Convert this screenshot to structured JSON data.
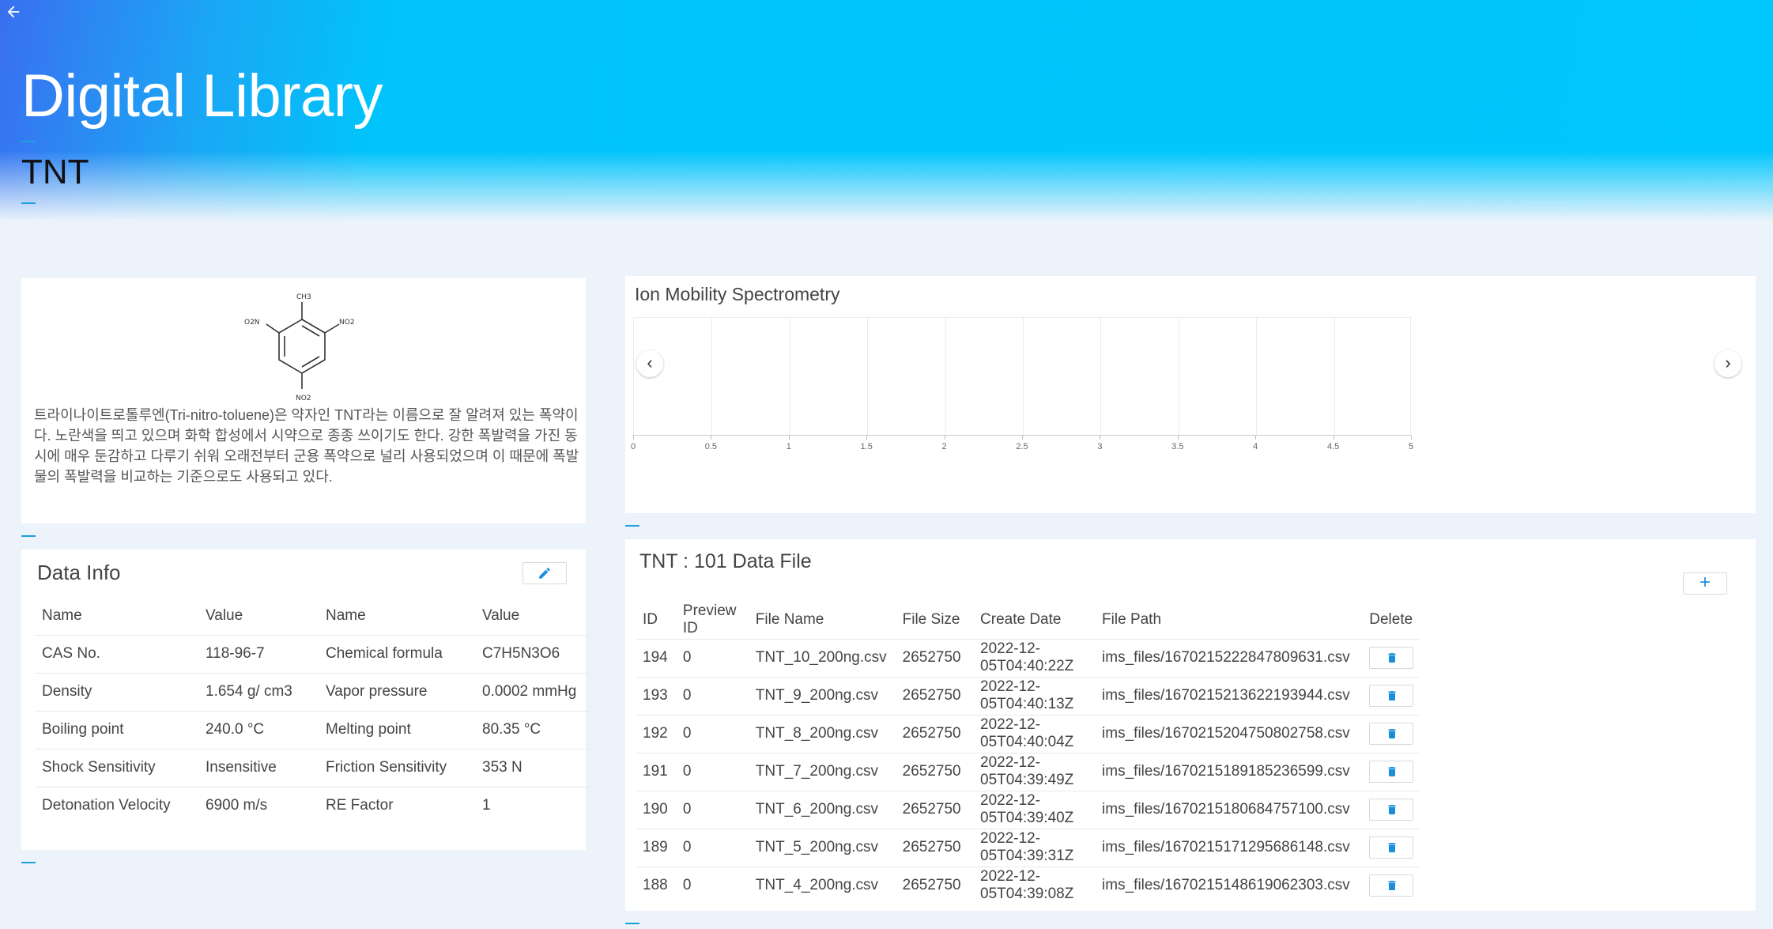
{
  "header": {
    "title": "Digital Library",
    "subtitle": "TNT"
  },
  "compound": {
    "structure_labels": {
      "top": "CH3",
      "left": "O2N",
      "right": "NO2",
      "bottom": "NO2"
    },
    "description": "트라이나이트로톨루엔(Tri-nitro-toluene)은 약자인 TNT라는 이름으로 잘 알려져 있는 폭약이다. 노란색을 띄고 있으며 화학 합성에서 시약으로 종종 쓰이기도 한다. 강한 폭발력을 가진 동시에 매우 둔감하고 다루기 쉬워 오래전부터 군용 폭약으로 널리 사용되었으며 이 때문에 폭발물의 폭발력을 비교하는 기준으로도 사용되고 있다."
  },
  "data_info": {
    "title": "Data Info",
    "edit_icon": "pencil-icon",
    "columns": [
      "Name",
      "Value",
      "Name",
      "Value"
    ],
    "rows": [
      [
        "CAS No.",
        "118-96-7",
        "Chemical formula",
        "C7H5N3O6"
      ],
      [
        "Density",
        "1.654 g/ cm3",
        "Vapor pressure",
        "0.0002 mmHg"
      ],
      [
        "Boiling point",
        "240.0 °C",
        "Melting point",
        "80.35 °C"
      ],
      [
        "Shock Sensitivity",
        "Insensitive",
        "Friction Sensitivity",
        "353 N"
      ],
      [
        "Detonation Velocity",
        "6900 m/s",
        "RE Factor",
        "1"
      ]
    ]
  },
  "ims": {
    "title": "Ion Mobility Spectrometry",
    "prev_label": "‹",
    "next_label": "›",
    "chart_data": {
      "type": "line",
      "title": "Ion Mobility Spectrometry",
      "x_ticks": [
        "0",
        "0.5",
        "1",
        "1.5",
        "2",
        "2.5",
        "3",
        "3.5",
        "4",
        "4.5",
        "5"
      ],
      "xlim": [
        0,
        5
      ],
      "series": [],
      "grid": true
    }
  },
  "files": {
    "title": "TNT : 101 Data File",
    "add_label": "+",
    "delete_icon": "trash-icon",
    "columns": [
      "ID",
      "Preview ID",
      "File Name",
      "File Size",
      "Create Date",
      "File Path",
      "Delete"
    ],
    "rows": [
      [
        "194",
        "0",
        "TNT_10_200ng.csv",
        "2652750",
        "2022-12-05T04:40:22Z",
        "ims_files/1670215222847809631.csv"
      ],
      [
        "193",
        "0",
        "TNT_9_200ng.csv",
        "2652750",
        "2022-12-05T04:40:13Z",
        "ims_files/1670215213622193944.csv"
      ],
      [
        "192",
        "0",
        "TNT_8_200ng.csv",
        "2652750",
        "2022-12-05T04:40:04Z",
        "ims_files/1670215204750802758.csv"
      ],
      [
        "191",
        "0",
        "TNT_7_200ng.csv",
        "2652750",
        "2022-12-05T04:39:49Z",
        "ims_files/1670215189185236599.csv"
      ],
      [
        "190",
        "0",
        "TNT_6_200ng.csv",
        "2652750",
        "2022-12-05T04:39:40Z",
        "ims_files/1670215180684757100.csv"
      ],
      [
        "189",
        "0",
        "TNT_5_200ng.csv",
        "2652750",
        "2022-12-05T04:39:31Z",
        "ims_files/1670215171295686148.csv"
      ],
      [
        "188",
        "0",
        "TNT_4_200ng.csv",
        "2652750",
        "2022-12-05T04:39:08Z",
        "ims_files/1670215148619062303.csv"
      ]
    ]
  }
}
